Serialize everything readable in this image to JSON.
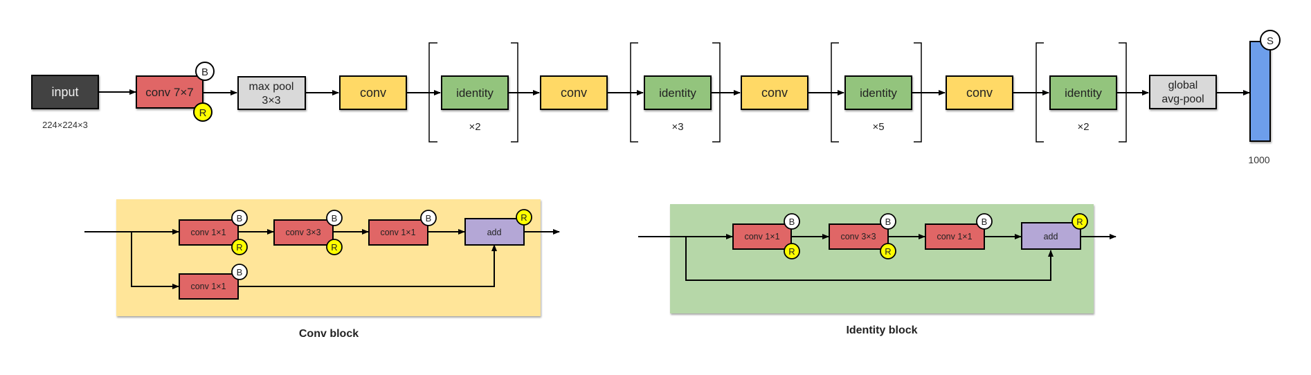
{
  "colors": {
    "input": "#424242",
    "conv_bn_relu": "#e06666",
    "pool": "#d9d9d9",
    "conv_block": "#ffd966",
    "identity_block": "#93c47d",
    "add": "#b4a7d6",
    "dense": "#6d9eeb",
    "batchnorm_badge": "#ffffff",
    "relu_badge": "#ffff00",
    "conv_block_panel": "#ffe599",
    "identity_block_panel": "#b6d7a8"
  },
  "main_pipeline": {
    "input": {
      "label": "input",
      "shape": "224×224×3"
    },
    "stem_conv": {
      "label": "conv 7×7",
      "badges": [
        "B",
        "R"
      ]
    },
    "max_pool": {
      "label_line1": "max pool",
      "label_line2": "3×3"
    },
    "stages": [
      {
        "conv_label": "conv",
        "identity_label": "identity",
        "repeat": "×2"
      },
      {
        "conv_label": "conv",
        "identity_label": "identity",
        "repeat": "×3"
      },
      {
        "conv_label": "conv",
        "identity_label": "identity",
        "repeat": "×5"
      },
      {
        "conv_label": "conv",
        "identity_label": "identity",
        "repeat": "×2"
      }
    ],
    "global_pool": {
      "label_line1": "global",
      "label_line2": "avg-pool"
    },
    "output": {
      "badge": "S",
      "units": "1000"
    }
  },
  "conv_block": {
    "title": "Conv block",
    "main_path": [
      {
        "label": "conv 1×1",
        "badges": [
          "B",
          "R"
        ]
      },
      {
        "label": "conv 3×3",
        "badges": [
          "B",
          "R"
        ]
      },
      {
        "label": "conv 1×1",
        "badges": [
          "B"
        ]
      }
    ],
    "shortcut": {
      "label": "conv 1×1",
      "badges": [
        "B"
      ]
    },
    "merge": {
      "label": "add",
      "badges": [
        "R"
      ]
    }
  },
  "identity_block": {
    "title": "Identity block",
    "main_path": [
      {
        "label": "conv 1×1",
        "badges": [
          "B",
          "R"
        ]
      },
      {
        "label": "conv 3×3",
        "badges": [
          "B",
          "R"
        ]
      },
      {
        "label": "conv 1×1",
        "badges": [
          "B"
        ]
      }
    ],
    "merge": {
      "label": "add",
      "badges": [
        "R"
      ]
    }
  }
}
